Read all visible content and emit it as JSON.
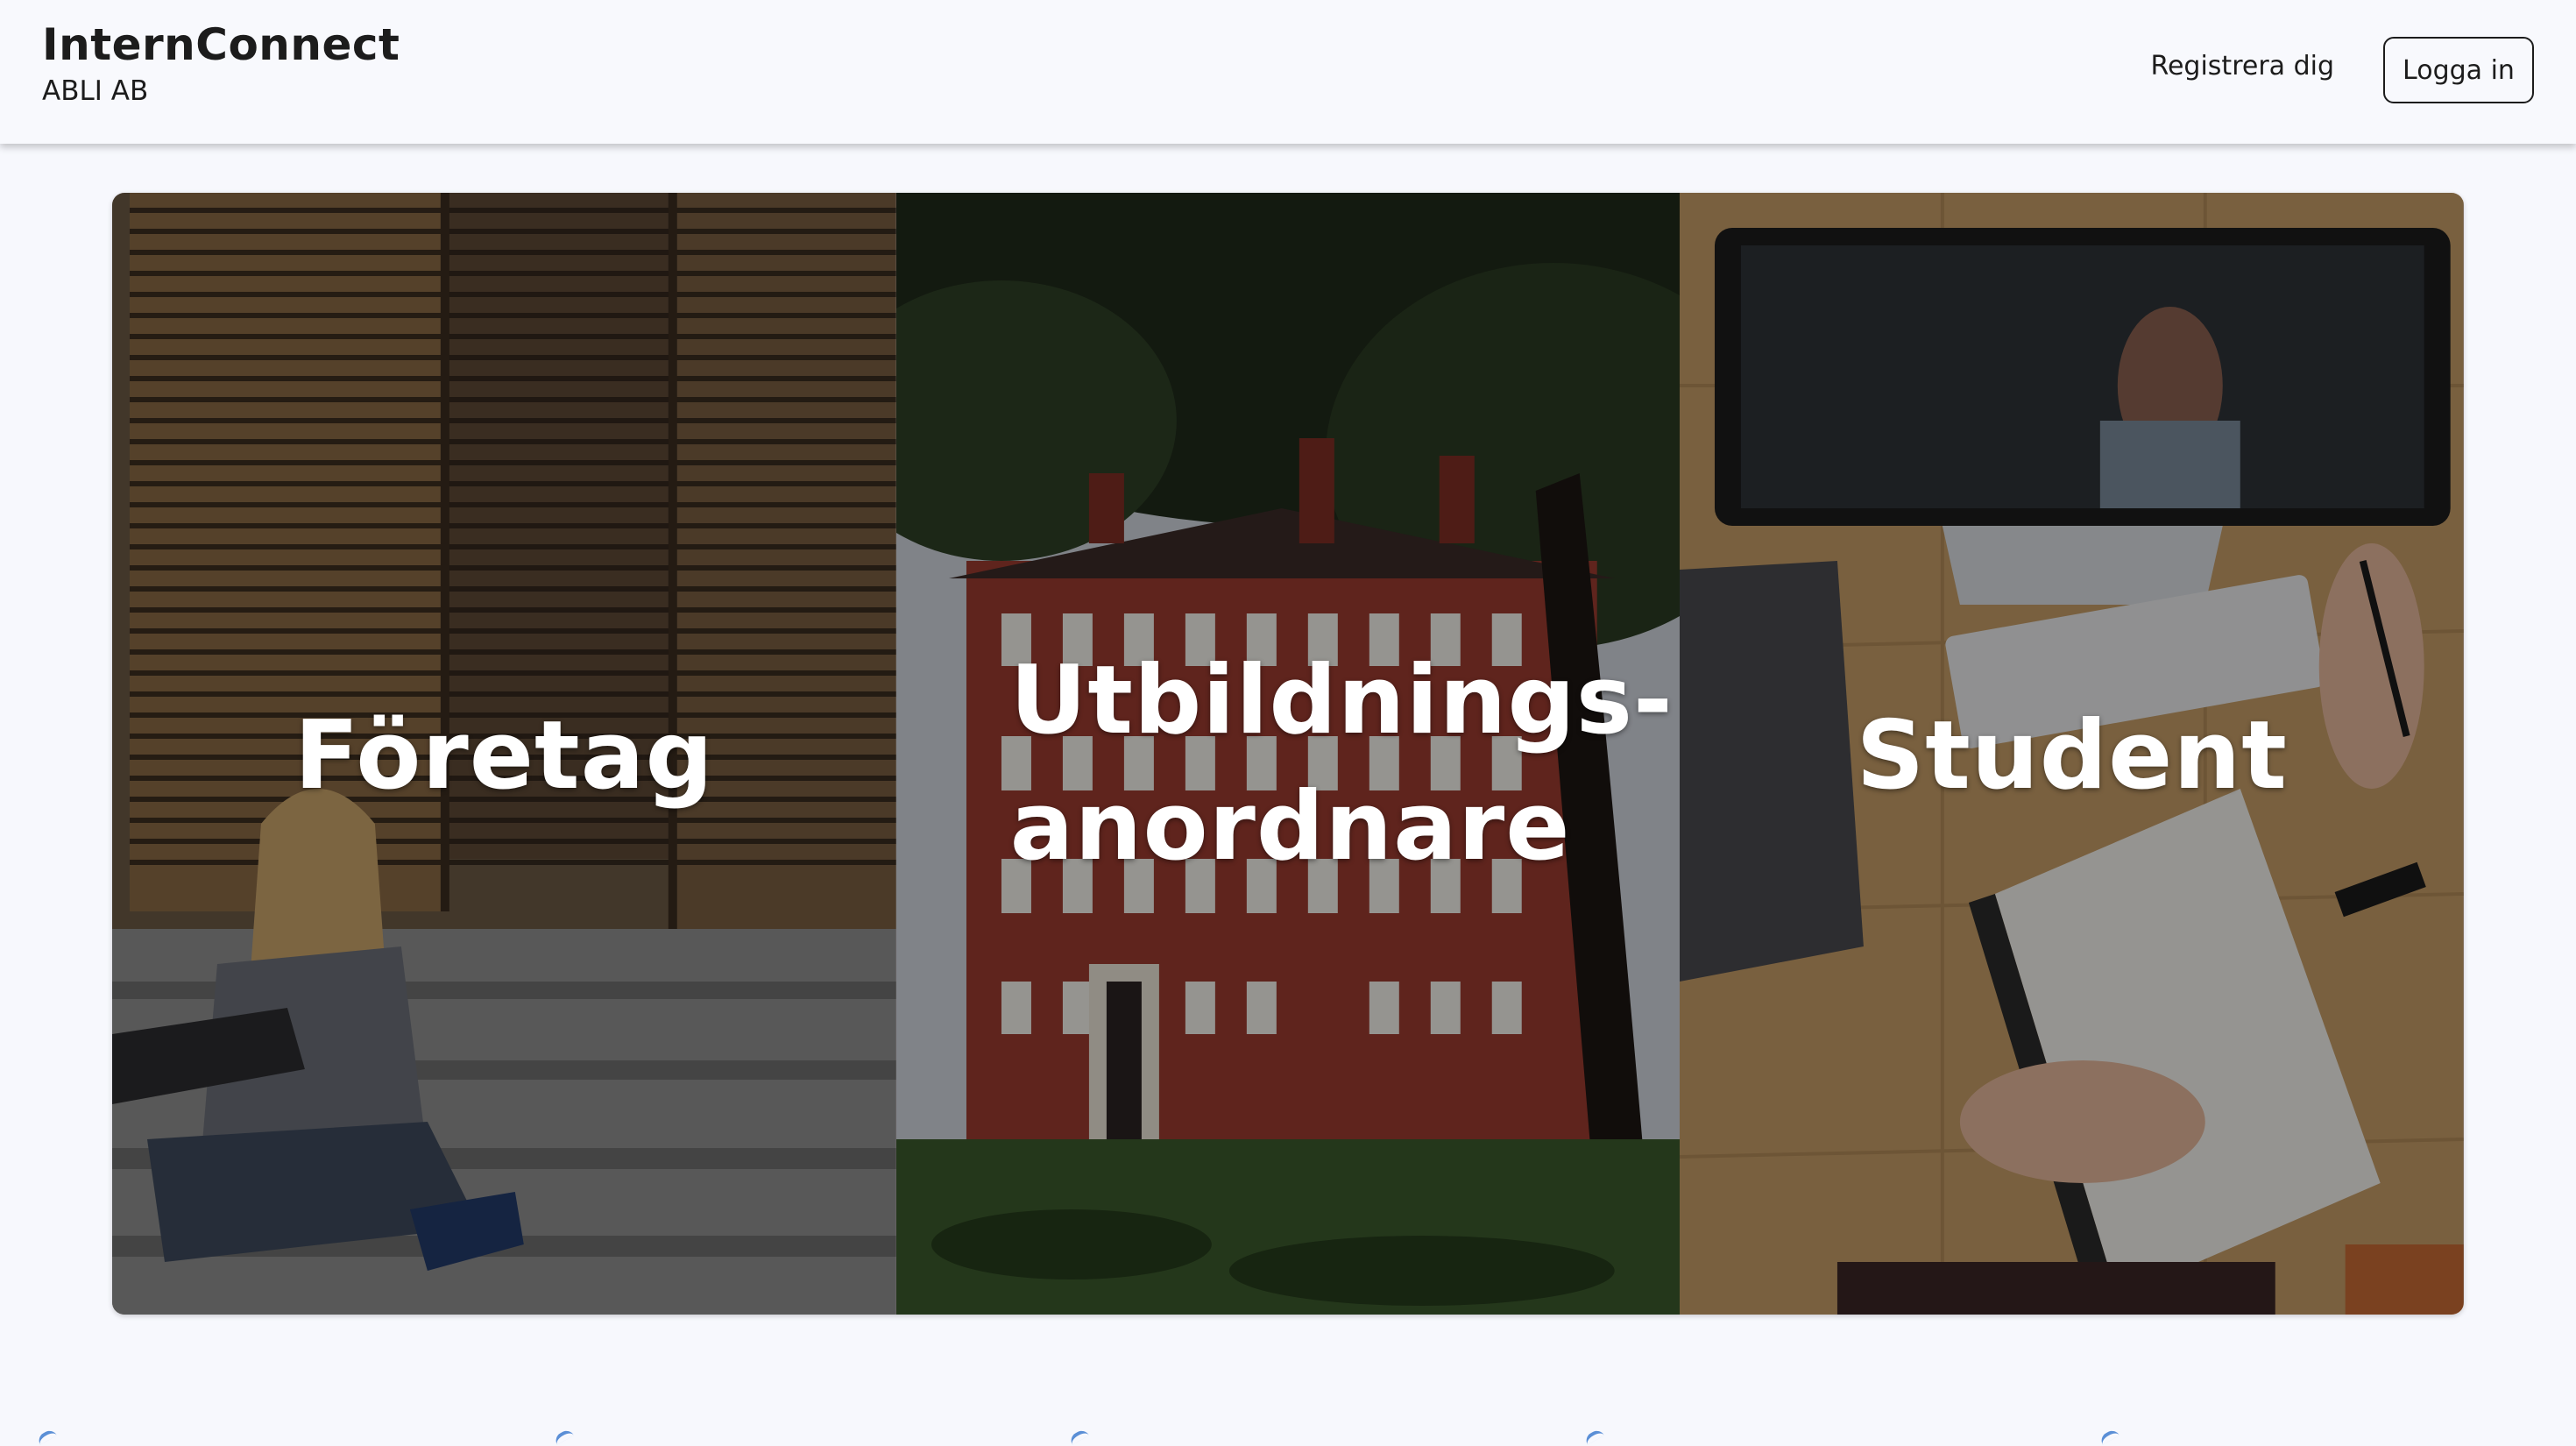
{
  "header": {
    "title": "InternConnect",
    "subtitle": "ABLI AB",
    "register_label": "Registrera dig",
    "login_label": "Logga in"
  },
  "panels": [
    {
      "id": "foretag",
      "label": "Företag",
      "image": "woman-on-steps-photo"
    },
    {
      "id": "utbildningsanordnare",
      "label_line1": "Utbildnings-",
      "label_line2": "anordnare",
      "image": "red-brick-school-photo"
    },
    {
      "id": "student",
      "label": "Student",
      "image": "desk-with-computer-photo"
    }
  ],
  "colors": {
    "background": "#f7f8fd",
    "text": "#1c1c1c",
    "overlay_text": "#ffffff"
  }
}
